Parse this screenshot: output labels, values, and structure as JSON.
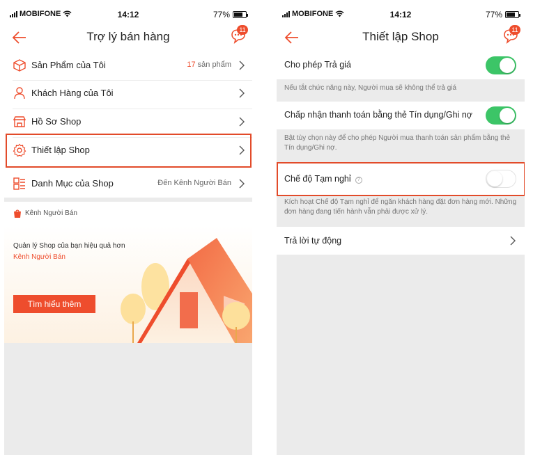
{
  "left_screen": {
    "status": {
      "carrier": "MOBIFONE",
      "time": "14:12",
      "battery": "77%"
    },
    "header": {
      "title": "Trợ lý bán hàng",
      "chat_badge": "11"
    },
    "menu": [
      {
        "label": "Sản Phẩm của Tôi",
        "value_count": "17",
        "value_suffix": " sản phẩm",
        "icon": "box-icon"
      },
      {
        "label": "Khách Hàng của Tôi",
        "icon": "customers-icon"
      },
      {
        "label": "Hồ Sơ Shop",
        "icon": "shop-profile-icon"
      },
      {
        "label": "Thiết lập Shop",
        "icon": "gear-icon"
      },
      {
        "label": "Danh Mục của Shop",
        "value": "Đến Kênh Người Bán",
        "icon": "category-icon"
      }
    ],
    "seller_channel": {
      "title": "Kênh Người Bán",
      "promo_line1": "Quản lý Shop của bạn hiệu quả hơn",
      "promo_line2": "Kênh Người Bán",
      "button": "Tìm hiểu thêm"
    }
  },
  "right_screen": {
    "status": {
      "carrier": "MOBIFONE",
      "time": "14:12",
      "battery": "77%"
    },
    "header": {
      "title": "Thiết lập Shop",
      "chat_badge": "11"
    },
    "settings": [
      {
        "label": "Cho phép Trả giá",
        "enabled": true,
        "note": "Nếu tắt chức năng này, Người mua sẽ không thể trả giá"
      },
      {
        "label": "Chấp nhận thanh toán bằng thẻ Tín dụng/Ghi nợ",
        "enabled": true,
        "note": "Bật tùy chọn này để cho phép Người mua thanh toán sản phẩm bằng thẻ Tín dụng/Ghi nợ."
      },
      {
        "label": "Chế độ Tạm nghỉ",
        "enabled": false,
        "help_icon": "question-icon",
        "note": "Kích hoạt Chế độ Tạm nghỉ để ngăn khách hàng đặt đơn hàng mới. Những đơn hàng đang tiến hành vẫn phải được xử lý."
      }
    ],
    "auto_reply": {
      "label": "Trả lời tự động"
    }
  },
  "colors": {
    "accent": "#ee4d2d",
    "toggle_on": "#3cc567",
    "highlight": "#e24b2a",
    "background_gray": "#ebebeb"
  }
}
